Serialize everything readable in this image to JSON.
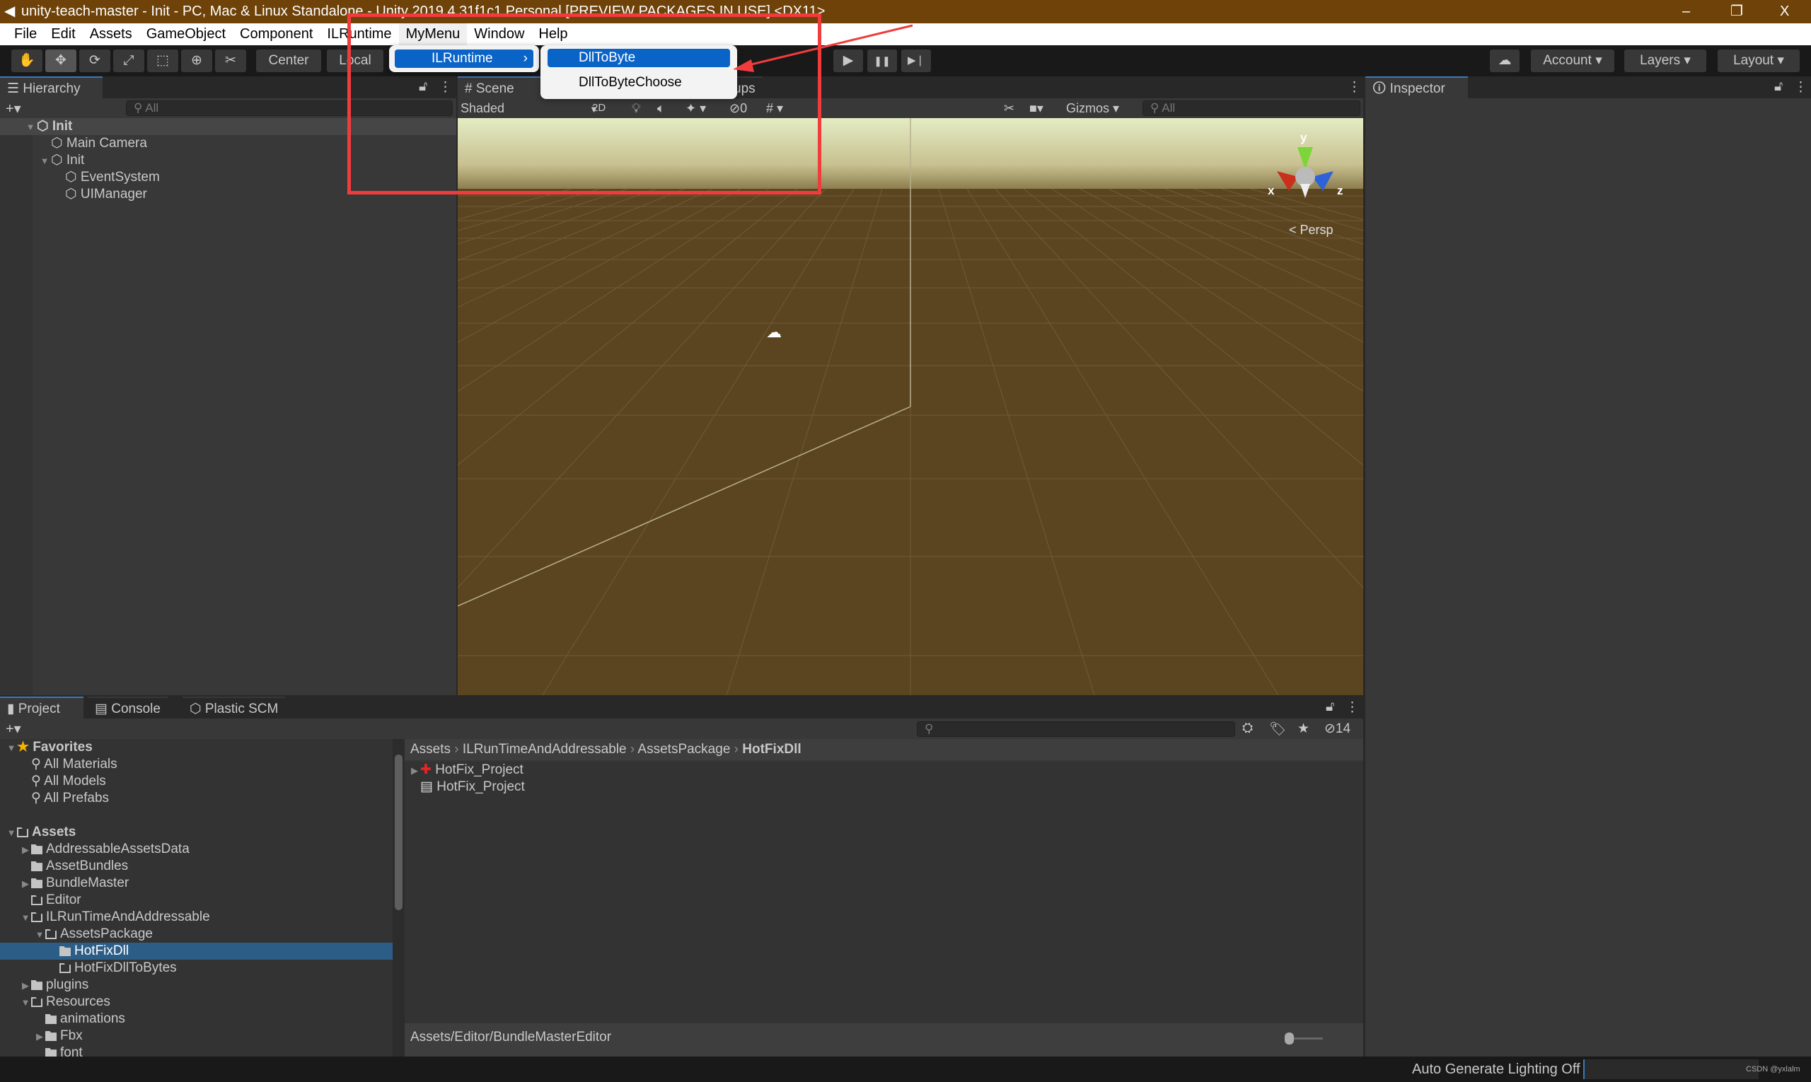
{
  "window": {
    "title": "unity-teach-master - Init - PC, Mac & Linux Standalone - Unity 2019.4.31f1c1 Personal [PREVIEW PACKAGES IN USE] <DX11>",
    "minimize": "–",
    "restore": "❐",
    "close": "X"
  },
  "menubar": [
    "File",
    "Edit",
    "Assets",
    "GameObject",
    "Component",
    "ILRuntime",
    "MyMenu",
    "Window",
    "Help"
  ],
  "mymenu": {
    "item": "ILRuntime",
    "arrow": "›",
    "submenu": [
      "DllToByte",
      "DllToByteChoose"
    ],
    "selected": "DllToByte"
  },
  "toolbar": {
    "tools": [
      "hand-tool",
      "move-tool",
      "rotate-tool",
      "scale-tool",
      "rect-tool",
      "transform-tool",
      "custom-tool"
    ],
    "tool_glyphs": [
      "✋",
      "✥",
      "⟳",
      "⤢",
      "⬚",
      "⊕",
      "✂"
    ],
    "pivot": "Center",
    "space": "Local",
    "play": "▶",
    "pause": "❚❚",
    "step": "▶❘",
    "account": "Account",
    "layers": "Layers",
    "layout": "Layout",
    "caret": "▾"
  },
  "hierarchy": {
    "tab": "Hierarchy",
    "search_placeholder": "All",
    "add": "+▾",
    "items": [
      {
        "label": "Init",
        "depth": 0,
        "expanded": true,
        "scene": true
      },
      {
        "label": "Main Camera",
        "depth": 1
      },
      {
        "label": "Init",
        "depth": 1,
        "expanded": true
      },
      {
        "label": "EventSystem",
        "depth": 2
      },
      {
        "label": "UIManager",
        "depth": 2
      }
    ]
  },
  "scene": {
    "tabs": [
      "Scene",
      "ups"
    ],
    "shading": "Shaded",
    "mode2d": "2D",
    "hidden_count": "0",
    "gizmos": "Gizmos",
    "search_placeholder": "All",
    "projection": "Persp",
    "axes": {
      "x": "x",
      "y": "y",
      "z": "z"
    },
    "colors": {
      "x": "#c8301c",
      "y": "#7cd63a",
      "z": "#2e63d8"
    }
  },
  "inspector": {
    "tab": "Inspector"
  },
  "bottom": {
    "tabs": [
      "Project",
      "Console",
      "Plastic SCM"
    ],
    "active": "Project",
    "add": "+▾",
    "hidden_count": "14"
  },
  "project": {
    "tree": [
      {
        "label": "Favorites",
        "depth": 0,
        "arrow": "▼",
        "icon": "star",
        "bold": true
      },
      {
        "label": "All Materials",
        "depth": 1,
        "icon": "search"
      },
      {
        "label": "All Models",
        "depth": 1,
        "icon": "search"
      },
      {
        "label": "All Prefabs",
        "depth": 1,
        "icon": "search"
      },
      {
        "label": "",
        "depth": 0
      },
      {
        "label": "Assets",
        "depth": 0,
        "arrow": "▼",
        "icon": "folder-open",
        "bold": true
      },
      {
        "label": "AddressableAssetsData",
        "depth": 1,
        "arrow": "▶",
        "icon": "folder"
      },
      {
        "label": "AssetBundles",
        "depth": 1,
        "icon": "folder"
      },
      {
        "label": "BundleMaster",
        "depth": 1,
        "arrow": "▶",
        "icon": "folder"
      },
      {
        "label": "Editor",
        "depth": 1,
        "icon": "folder-open"
      },
      {
        "label": "ILRunTimeAndAddressable",
        "depth": 1,
        "arrow": "▼",
        "icon": "folder-open"
      },
      {
        "label": "AssetsPackage",
        "depth": 2,
        "arrow": "▼",
        "icon": "folder-open"
      },
      {
        "label": "HotFixDll",
        "depth": 3,
        "icon": "folder",
        "selected": true
      },
      {
        "label": "HotFixDllToBytes",
        "depth": 3,
        "icon": "folder-empty"
      },
      {
        "label": "plugins",
        "depth": 1,
        "arrow": "▶",
        "icon": "folder"
      },
      {
        "label": "Resources",
        "depth": 1,
        "arrow": "▼",
        "icon": "folder-open"
      },
      {
        "label": "animations",
        "depth": 2,
        "icon": "folder"
      },
      {
        "label": "Fbx",
        "depth": 2,
        "arrow": "▶",
        "icon": "folder"
      },
      {
        "label": "font",
        "depth": 2,
        "icon": "folder"
      }
    ],
    "breadcrumb": [
      "Assets",
      "ILRunTimeAndAddressable",
      "AssetsPackage",
      "HotFixDll"
    ],
    "files": [
      "HotFix_Project",
      "HotFix_Project"
    ],
    "footer_path": "Assets/Editor/BundleMasterEditor"
  },
  "status": {
    "text": "Auto Generate Lighting Off",
    "watermark": "CSDN @yxlalm"
  },
  "annotation": {
    "color": "#f03c3c"
  }
}
